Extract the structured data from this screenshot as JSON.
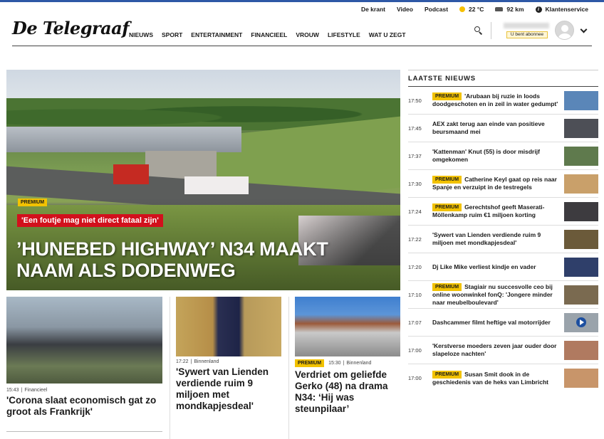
{
  "utility": {
    "links": [
      "De krant",
      "Video",
      "Podcast"
    ],
    "weather": "22 °C",
    "traffic": "92 km",
    "service": "Klantenservice"
  },
  "header": {
    "logo": "De Telegraaf",
    "nav": [
      "NIEUWS",
      "SPORT",
      "ENTERTAINMENT",
      "FINANCIEEL",
      "VROUW",
      "LIFESTYLE",
      "WAT U ZEGT"
    ],
    "subscriber_label": "U bent abonnee"
  },
  "hero": {
    "badge": "PREMIUM",
    "quote": "'Een foutje mag niet direct fataal zijn'",
    "title": "’HUNEBED HIGHWAY’ N34 MAAKT NAAM ALS DODENWEG"
  },
  "cards": [
    {
      "time": "15:43",
      "section": "Financieel",
      "badge": "",
      "title": "'Corona slaat economisch gat zo groot als Frankrijk'"
    },
    {
      "time": "17:22",
      "section": "Binnenland",
      "badge": "",
      "title": "'Sywert van Lienden verdiende ruim 9 miljoen met mondkapjesdeal'"
    },
    {
      "time": "15:30",
      "section": "Binnenland",
      "badge": "PREMIUM",
      "title": "Verdriet om geliefde Gerko (48) na drama N34: ‘Hij was steunpilaar’"
    }
  ],
  "sidebar": {
    "title": "LAATSTE NIEUWS",
    "items": [
      {
        "time": "17:50",
        "badge": "PREMIUM",
        "headline": "'Arubaan bij ruzie in loods doodgeschoten en in zeil in water gedumpt'",
        "thumb_color": "#5a86b8"
      },
      {
        "time": "17:45",
        "badge": "",
        "headline": "AEX zakt terug aan einde van positieve beursmaand mei",
        "thumb_color": "#4d4f56"
      },
      {
        "time": "17:37",
        "badge": "",
        "headline": "'Kattenman' Knut (55) is door misdrijf omgekomen",
        "thumb_color": "#5f7a4d"
      },
      {
        "time": "17:30",
        "badge": "PREMIUM",
        "headline": "Catherine Keyl gaat op reis naar Spanje en verzuipt in de testregels",
        "thumb_color": "#c9a06a"
      },
      {
        "time": "17:24",
        "badge": "PREMIUM",
        "headline": "Gerechtshof geeft Maserati-Möllenkamp ruim €1 miljoen korting",
        "thumb_color": "#3d3b3f"
      },
      {
        "time": "17:22",
        "badge": "",
        "headline": "'Sywert van Lienden verdiende ruim 9 miljoen met mondkapjesdeal'",
        "thumb_color": "#6b5a3a"
      },
      {
        "time": "17:20",
        "badge": "",
        "headline": "Dj Like Mike verliest kindje en vader",
        "thumb_color": "#2f3f6a"
      },
      {
        "time": "17:10",
        "badge": "PREMIUM",
        "headline": "Stagiair nu succesvolle ceo bij online woonwinkel fonQ: 'Jongere minder naar meubelboulevard'",
        "thumb_color": "#7a6a50"
      },
      {
        "time": "17:07",
        "badge": "",
        "headline": "Dashcammer filmt heftige val motorrijder",
        "thumb_color": "#9aa3ab"
      },
      {
        "time": "17:00",
        "badge": "",
        "headline": "'Kerstverse moeders zeven jaar ouder door slapeloze nachten'",
        "thumb_color": "#b07a60"
      },
      {
        "time": "17:00",
        "badge": "PREMIUM",
        "headline": "Susan Smit dook in de geschiedenis van de heks van Limbricht",
        "thumb_color": "#c8956a"
      }
    ]
  },
  "colors": {
    "accent": "#2e58a6",
    "premium": "#f2c200",
    "quote_red": "#d2101c"
  }
}
